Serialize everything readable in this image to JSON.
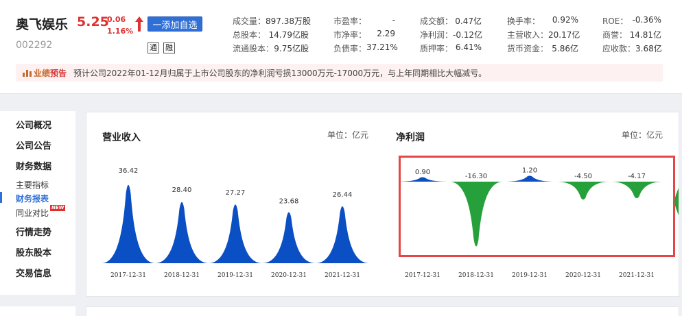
{
  "stock": {
    "name": "奥飞娱乐",
    "price": "5.25",
    "change": "0.06",
    "change_pct": "1.16%",
    "code": "002292",
    "add_watch_label": "一添加自选",
    "flag_tong": "通",
    "flag_rong": "融",
    "price_color": "#e03030"
  },
  "metrics": [
    [
      {
        "label": "成交量：",
        "value": "897.38万股"
      },
      {
        "label": "总股本：",
        "value": "14.79亿股"
      },
      {
        "label": "流通股本：",
        "value": "9.75亿股"
      }
    ],
    [
      {
        "label": "市盈率：",
        "value": "-"
      },
      {
        "label": "市净率：",
        "value": "2.29"
      },
      {
        "label": "负债率：",
        "value": "37.21%"
      }
    ],
    [
      {
        "label": "成交额：",
        "value": "0.47亿"
      },
      {
        "label": "净利润：",
        "value": "-0.12亿"
      },
      {
        "label": "质押率：",
        "value": "6.41%"
      }
    ],
    [
      {
        "label": "换手率：",
        "value": "0.92%"
      },
      {
        "label": "主营收入：",
        "value": "20.17亿"
      },
      {
        "label": "货币资金：",
        "value": "5.86亿"
      }
    ],
    [
      {
        "label": "ROE：",
        "value": "-0.36%"
      },
      {
        "label": "商誉：",
        "value": "14.81亿"
      },
      {
        "label": "应收款：",
        "value": "3.68亿"
      }
    ]
  ],
  "notice": {
    "badge_main": "业绩",
    "badge_tag": "预告",
    "text": "预计公司2022年01-12月归属于上市公司股东的净利润亏损13000万元-17000万元，与上年同期相比大幅减亏。"
  },
  "sidebar": {
    "items": [
      "公司概况",
      "公司公告",
      "财务数据"
    ],
    "subs": [
      "主要指标",
      "财务报表",
      "同业对比"
    ],
    "new_badge": "NEW",
    "items2": [
      "行情走势",
      "股东股本",
      "交易信息"
    ]
  },
  "charts": {
    "revenue_title": "营业收入",
    "revenue_unit": "单位：亿元",
    "profit_title": "净利润",
    "profit_unit": "单位：亿元"
  },
  "chart_data": [
    {
      "type": "area",
      "title": "营业收入",
      "unit": "亿元",
      "categories": [
        "2017-12-31",
        "2018-12-31",
        "2019-12-31",
        "2020-12-31",
        "2021-12-31"
      ],
      "values": [
        36.42,
        28.4,
        27.27,
        23.68,
        26.44
      ],
      "labels": [
        "36.42",
        "28.40",
        "27.27",
        "23.68",
        "26.44"
      ],
      "color": "#0b4fc4"
    },
    {
      "type": "area",
      "title": "净利润",
      "unit": "亿元",
      "categories": [
        "2017-12-31",
        "2018-12-31",
        "2019-12-31",
        "2020-12-31",
        "2021-12-31"
      ],
      "values": [
        0.9,
        -16.3,
        1.2,
        -4.5,
        -4.17
      ],
      "labels": [
        "0.90",
        "-16.30",
        "1.20",
        "-4.50",
        "-4.17"
      ],
      "positive_color": "#0b4fc4",
      "negative_color": "#26a03a"
    }
  ]
}
